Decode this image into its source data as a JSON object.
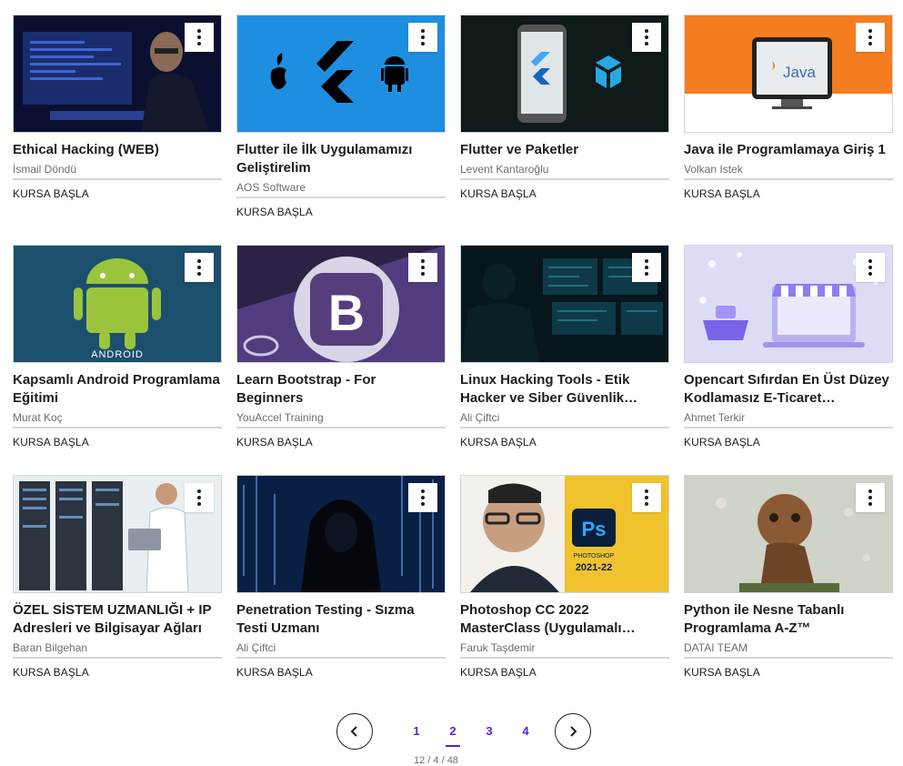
{
  "menu_button_label": "Course options",
  "cta_label": "KURSA BAŞLA",
  "accent_color": "#5624d0",
  "courses": [
    {
      "title": "Ethical Hacking (WEB)",
      "instructor": "İsmail Döndü",
      "thumb": "hacker-monitor"
    },
    {
      "title": "Flutter ile İlk Uygulamamızı Geliştirelim",
      "instructor": "AOS Software",
      "thumb": "flutter-logo"
    },
    {
      "title": "Flutter ve Paketler",
      "instructor": "Levent Kantaroğlu",
      "thumb": "flutter-phone"
    },
    {
      "title": "Java ile Programlamaya Giriş 1",
      "instructor": "Volkan Istek",
      "thumb": "java-monitor"
    },
    {
      "title": "Kapsamlı Android Programlama Eğitimi",
      "instructor": "Murat Koç",
      "thumb": "android-robot"
    },
    {
      "title": "Learn Bootstrap - For Beginners",
      "instructor": "YouAccel Training",
      "thumb": "bootstrap-logo"
    },
    {
      "title": "Linux Hacking Tools - Etik Hacker ve Siber Güvenlik…",
      "instructor": "Ali Çiftci",
      "thumb": "hacker-room"
    },
    {
      "title": "Opencart Sıfırdan En Üst Düzey Kodlamasız E-Ticaret…",
      "instructor": "Ahmet Terkir",
      "thumb": "shop-laptop"
    },
    {
      "title": "ÖZEL SİSTEM UZMANLIĞI + IP Adresleri ve Bilgisayar Ağları",
      "instructor": "Baran Bilgehan",
      "thumb": "server-room"
    },
    {
      "title": "Penetration Testing - Sızma Testi Uzmanı",
      "instructor": "Ali Çiftci",
      "thumb": "hooded-hacker"
    },
    {
      "title": "Photoshop CC 2022 MasterClass (Uygulamalı…",
      "instructor": "Faruk Taşdemir",
      "thumb": "photoshop"
    },
    {
      "title": "Python ile Nesne Tabanlı Programlama A-Z™",
      "instructor": "DATAI TEAM",
      "thumb": "robot-figure"
    }
  ],
  "thumb_text": {
    "java": "Java",
    "android": "ANDROID",
    "bootstrap": "B",
    "ps": "Ps",
    "ps_name": "PHOTOSHOP",
    "ps_year": "2021-22"
  },
  "pagination": {
    "pages": [
      "1",
      "2",
      "3",
      "4"
    ],
    "current": "2",
    "info": "12 / 4 / 48"
  }
}
